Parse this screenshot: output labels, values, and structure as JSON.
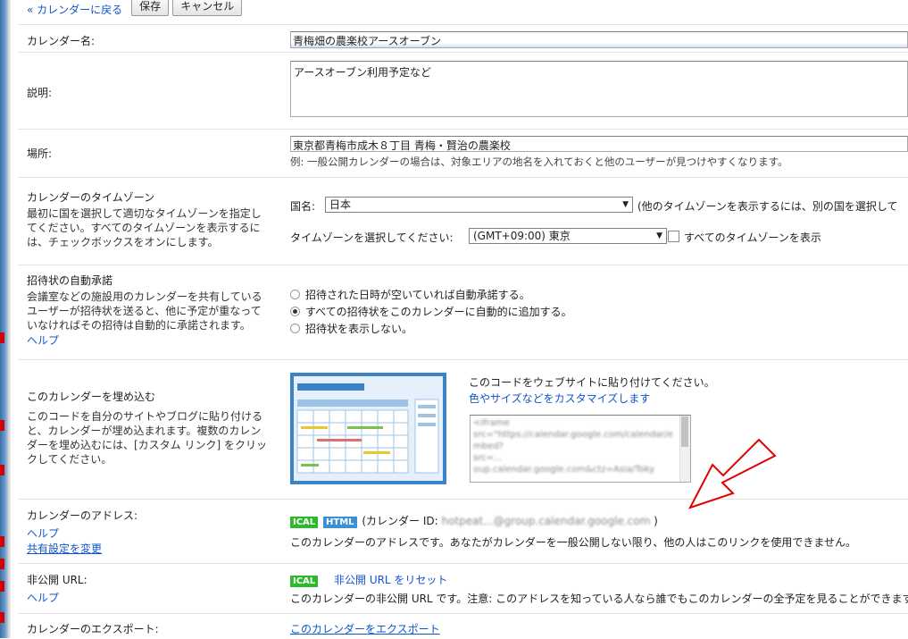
{
  "toolbar": {
    "back_label": "« カレンダーに戻る",
    "save_label": "保存",
    "cancel_label": "キャンセル"
  },
  "calendar_name": {
    "label": "カレンダー名:",
    "value": "青梅畑の農楽校アースオーブン"
  },
  "description": {
    "label": "説明:",
    "value": "アースオーブン利用予定など"
  },
  "location": {
    "label": "場所:",
    "value": "東京都青梅市成木８丁目 青梅・賢治の農楽校",
    "hint": "例: 一般公開カレンダーの場合は、対象エリアの地名を入れておくと他のユーザーが見つけやすくなります。"
  },
  "timezone": {
    "label": "カレンダーのタイムゾーン",
    "desc": "最初に国を選択して適切なタイムゾーンを指定してください。すべてのタイムゾーンを表示するには、チェックボックスをオンにします。",
    "country_label": "国名:",
    "country_value": "日本",
    "country_note": "(他のタイムゾーンを表示するには、別の国を選択して",
    "tz_label": "タイムゾーンを選択してください:",
    "tz_value": "(GMT+09:00) 東京",
    "show_all_label": "すべてのタイムゾーンを表示"
  },
  "auto_accept": {
    "label": "招待状の自動承諾",
    "desc": "会議室などの施設用のカレンダーを共有しているユーザーが招待状を送ると、他に予定が重なっていなければその招待は自動的に承諾されます。",
    "help": "ヘルプ",
    "options": [
      {
        "label": "招待された日時が空いていれば自動承諾する。",
        "selected": false
      },
      {
        "label": "すべての招待状をこのカレンダーに自動的に追加する。",
        "selected": true
      },
      {
        "label": "招待状を表示しない。",
        "selected": false
      }
    ]
  },
  "embed": {
    "label": "このカレンダーを埋め込む",
    "desc": "このコードを自分のサイトやブログに貼り付けると、カレンダーが埋め込まれます。複数のカレンダーを埋め込むには、[カスタム リンク] をクリックしてください。",
    "instruction": "このコードをウェブサイトに貼り付けてください。",
    "customize_link": "色やサイズなどをカスタマイズします",
    "code_lines": [
      "<iframe",
      "src=\"https://calendar.google.com/calendar/e",
      "mbed?",
      "src=...",
      "oup.calendar.google.com&ctz=Asia/Toky"
    ]
  },
  "address": {
    "label": "カレンダーのアドレス:",
    "help": "ヘルプ",
    "share_link": "共有設定を変更",
    "ical": "ICAL",
    "html": "HTML",
    "id_prefix": "(カレンダー ID:",
    "id_value": "hotpeat...@group.calendar.google.com",
    "id_suffix": ")",
    "note": "このカレンダーのアドレスです。あなたがカレンダーを一般公開しない限り、他の人はこのリンクを使用できません。"
  },
  "private_url": {
    "label": "非公開 URL:",
    "help": "ヘルプ",
    "ical": "ICAL",
    "reset_link": "非公開 URL をリセット",
    "note": "このカレンダーの非公開 URL です。注意: このアドレスを知っている人なら誰でもこのカレンダーの全予定を見ることができます。"
  },
  "export": {
    "label": "カレンダーのエクスポート:",
    "link": "このカレンダーをエクスポート"
  },
  "colors": {
    "link": "#1155cc",
    "arrow": "#e00000",
    "ical": "#2eb82e",
    "html": "#3b8fd4"
  }
}
